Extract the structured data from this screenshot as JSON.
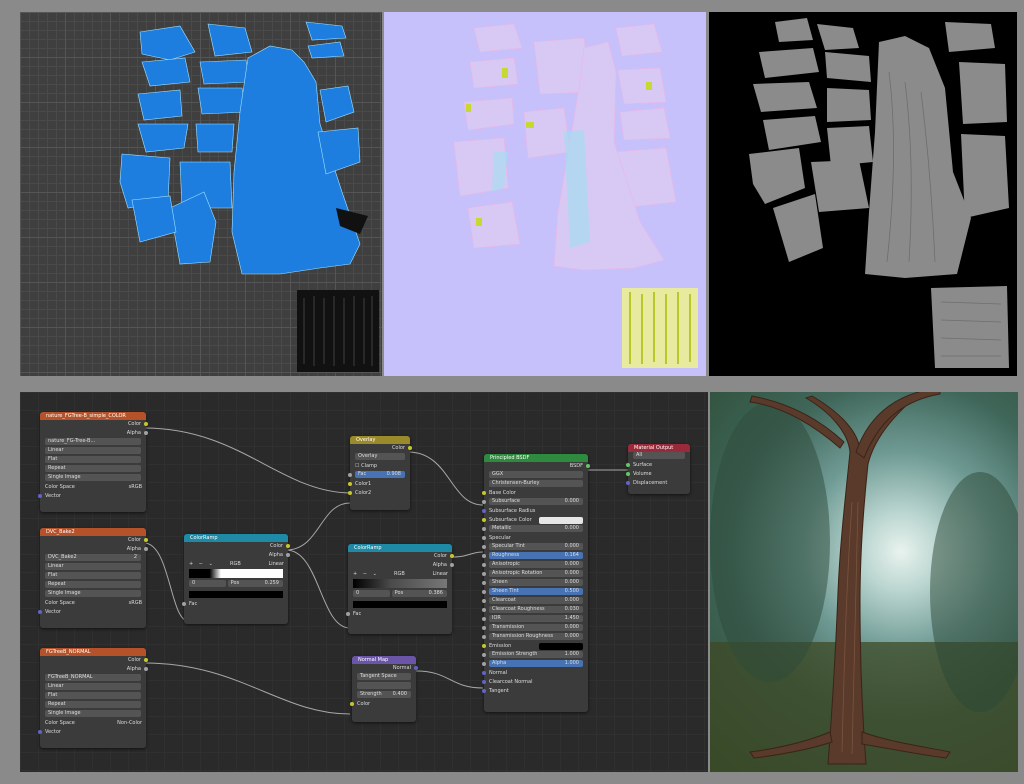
{
  "nodes": {
    "tex_color": {
      "title": "nature_FGTree-B_simple_COLOR",
      "out_color": "Color",
      "out_alpha": "Alpha",
      "image": "nature_FG-Tree-B...",
      "interp": "Linear",
      "proj": "Flat",
      "ext": "Repeat",
      "source": "Single Image",
      "cs_label": "Color Space",
      "cs_value": "sRGB",
      "in_vector": "Vector"
    },
    "tex_bake": {
      "title": "DVC_Bake2",
      "out_color": "Color",
      "out_alpha": "Alpha",
      "image": "DVC_Bake2",
      "count": "2",
      "interp": "Linear",
      "proj": "Flat",
      "ext": "Repeat",
      "source": "Single Image",
      "cs_label": "Color Space",
      "cs_value": "sRGB",
      "in_vector": "Vector"
    },
    "tex_normal": {
      "title": "FGTreeB_NORMAL",
      "out_color": "Color",
      "out_alpha": "Alpha",
      "image": "FGTreeB_NORMAL",
      "interp": "Linear",
      "proj": "Flat",
      "ext": "Repeat",
      "source": "Single Image",
      "cs_label": "Color Space",
      "cs_value": "Non-Color",
      "in_vector": "Vector"
    },
    "ramp1": {
      "title": "ColorRamp",
      "out_color": "Color",
      "out_alpha": "Alpha",
      "mode": "RGB",
      "interp": "Linear",
      "idx": "0",
      "pos_label": "Pos",
      "pos": "0.259",
      "in_fac": "Fac"
    },
    "ramp2": {
      "title": "ColorRamp",
      "out_color": "Color",
      "out_alpha": "Alpha",
      "mode": "RGB",
      "interp": "Linear",
      "idx": "0",
      "pos_label": "Pos",
      "pos": "0.386",
      "in_fac": "Fac"
    },
    "overlay": {
      "title": "Overlay",
      "out_color": "Color",
      "blend": "Overlay",
      "clamp": "Clamp",
      "fac_label": "Fac",
      "fac": "0.908",
      "in_color1": "Color1",
      "in_color2": "Color2"
    },
    "normalmap": {
      "title": "Normal Map",
      "out_normal": "Normal",
      "space": "Tangent Space",
      "strength_label": "Strength",
      "strength": "0.400",
      "in_color": "Color"
    },
    "bsdf": {
      "title": "Principled BSDF",
      "out": "BSDF",
      "dist": "GGX",
      "sss": "Christensen-Burley",
      "params": [
        {
          "label": "Base Color",
          "value": "",
          "kind": "socket"
        },
        {
          "label": "Subsurface",
          "value": "0.000",
          "kind": "field"
        },
        {
          "label": "Subsurface Radius",
          "value": "",
          "kind": "select"
        },
        {
          "label": "Subsurface Color",
          "value": "",
          "kind": "colorfield"
        },
        {
          "label": "Metallic",
          "value": "0.000",
          "kind": "field"
        },
        {
          "label": "Specular",
          "value": "",
          "kind": "socket"
        },
        {
          "label": "Specular Tint",
          "value": "0.000",
          "kind": "field"
        },
        {
          "label": "Roughness",
          "value": "0.164",
          "kind": "bluefield"
        },
        {
          "label": "Anisotropic",
          "value": "0.000",
          "kind": "field"
        },
        {
          "label": "Anisotropic Rotation",
          "value": "0.000",
          "kind": "field"
        },
        {
          "label": "Sheen",
          "value": "0.000",
          "kind": "field"
        },
        {
          "label": "Sheen Tint",
          "value": "0.500",
          "kind": "bluefield"
        },
        {
          "label": "Clearcoat",
          "value": "0.000",
          "kind": "field"
        },
        {
          "label": "Clearcoat Roughness",
          "value": "0.030",
          "kind": "field"
        },
        {
          "label": "IOR",
          "value": "1.450",
          "kind": "field"
        },
        {
          "label": "Transmission",
          "value": "0.000",
          "kind": "field"
        },
        {
          "label": "Transmission Roughness",
          "value": "0.000",
          "kind": "field"
        },
        {
          "label": "Emission",
          "value": "",
          "kind": "blackfield"
        },
        {
          "label": "Emission Strength",
          "value": "1.000",
          "kind": "field"
        },
        {
          "label": "Alpha",
          "value": "1.000",
          "kind": "bluefield"
        },
        {
          "label": "Normal",
          "value": "",
          "kind": "socket"
        },
        {
          "label": "Clearcoat Normal",
          "value": "",
          "kind": "socket"
        },
        {
          "label": "Tangent",
          "value": "",
          "kind": "socket"
        }
      ]
    },
    "output": {
      "title": "Material Output",
      "target": "All",
      "in_surface": "Surface",
      "in_volume": "Volume",
      "in_disp": "Displacement"
    }
  },
  "colors": {
    "node_bg": "#3b3b3b",
    "socket_color": "#c7c729",
    "socket_vector": "#6363c7",
    "socket_shader": "#63c763"
  }
}
